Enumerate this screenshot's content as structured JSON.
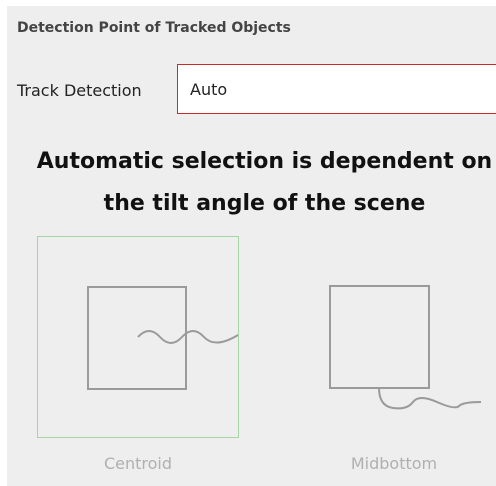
{
  "section": {
    "title": "Detection Point of Tracked Objects"
  },
  "track_detection": {
    "label": "Track Detection",
    "value": "Auto",
    "border_color": "#cc2a2a"
  },
  "info": {
    "line1": "Automatic selection is dependent on",
    "line2": "the tilt angle of the scene"
  },
  "options": [
    {
      "label": "Centroid",
      "selected": true,
      "icon": "centroid-diagram-icon"
    },
    {
      "label": "Midbottom",
      "selected": false,
      "icon": "midbottom-diagram-icon"
    }
  ],
  "colors": {
    "selected_border": "#a6d6a6",
    "diagram_stroke": "#9a9a9a",
    "disabled_label": "#b0b0b0"
  }
}
